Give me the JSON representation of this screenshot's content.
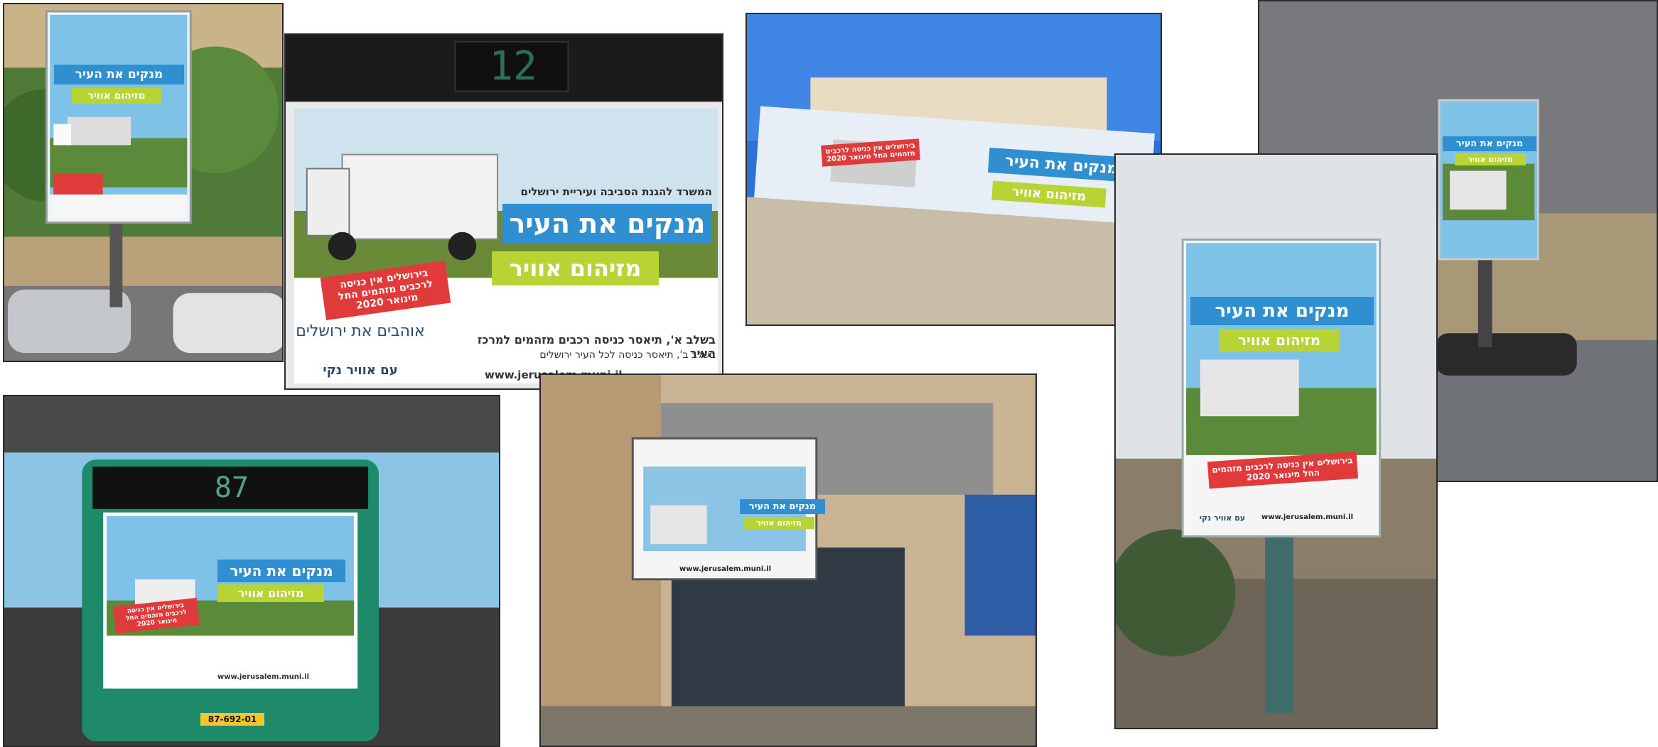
{
  "campaign": {
    "headline_main": "מנקים את העיר",
    "headline_sub": "מזיהום אוויר",
    "top_line": "המשרד להגנת הסביבה ועיריית ירושלים",
    "badge_text": "בירושלים אין כניסה לרכבים מזהמים החל מינואר 2020",
    "logo_text": "אוהבים את ירושלים",
    "logo_slogan": "עם אוויר נקי",
    "info_line_1": "בשלב א', תיאסר כניסה רכבים מזהמים למרכז העיר",
    "info_line_2": "בשלב ב', תיאסר כניסה לכל העיר ירושלים",
    "website": "www.jerusalem.muni.il"
  },
  "bus_display": {
    "route_top": "12",
    "route_rear": "87",
    "plate": "87-692-01"
  },
  "colors": {
    "headline_bg": "#2f8fd0",
    "sub_bg": "#b7d334",
    "badge_bg": "#e03a3a",
    "sky_poster": "#7fc2e8",
    "bus_green": "#1f8a6a"
  }
}
